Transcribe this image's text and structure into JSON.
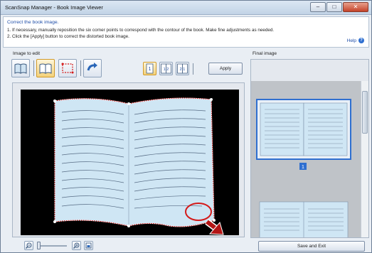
{
  "window": {
    "title": "ScanSnap Manager - Book Image Viewer",
    "controls": {
      "minimize": "–",
      "maximize": "□",
      "close": "✕"
    }
  },
  "instructions": {
    "heading": "Correct the book image.",
    "lines": [
      "1. If necessary, manually reposition the six corner points to correspond with the contour of the book. Make fine adjustments as needed.",
      "2. Click the [Apply] button to correct the distorted book image."
    ],
    "help_label": "Help",
    "help_icon": "question-icon"
  },
  "image_to_edit": {
    "label": "Image to edit",
    "tools": [
      {
        "name": "whole-book-mode-icon",
        "active": false
      },
      {
        "name": "book-correction-mode-icon",
        "active": true
      },
      {
        "name": "point-selection-icon",
        "active": false
      },
      {
        "name": "rotate-icon",
        "active": false
      }
    ],
    "page_modes": [
      {
        "label": "1",
        "active": true
      },
      {
        "label": "1 2",
        "active": false
      },
      {
        "label": "2 1",
        "active": false
      }
    ],
    "apply_label": "Apply"
  },
  "final_image": {
    "label": "Final image",
    "page_badge": "1"
  },
  "footer": {
    "save_label": "Save and Exit"
  },
  "colors": {
    "accent": "#1f4ea8",
    "selection": "#d41a1a",
    "page_fill": "#cfe6f4",
    "active_button": "#f4d27a"
  }
}
